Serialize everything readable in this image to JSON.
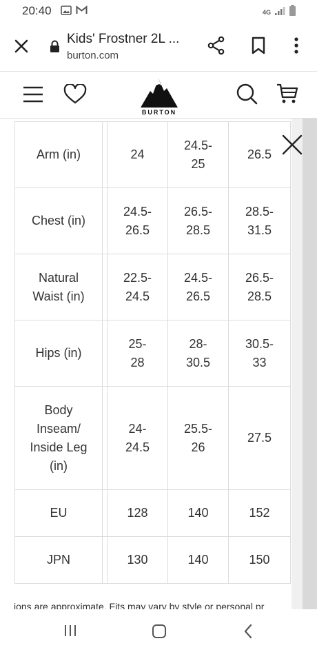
{
  "status": {
    "time": "20:40",
    "network": "4G"
  },
  "browser": {
    "title": "Kids' Frostner 2L ...",
    "url": "burton.com"
  },
  "site": {
    "logo_text": "BURTON"
  },
  "size_table": {
    "rows": [
      {
        "label": "Arm (in)",
        "values": [
          "24",
          "24.5-\n25",
          "26.5"
        ]
      },
      {
        "label": "Chest (in)",
        "values": [
          "24.5-\n26.5",
          "26.5-\n28.5",
          "28.5-\n31.5"
        ]
      },
      {
        "label": "Natural\nWaist (in)",
        "values": [
          "22.5-\n24.5",
          "24.5-\n26.5",
          "26.5-\n28.5"
        ]
      },
      {
        "label": "Hips (in)",
        "values": [
          "25-\n28",
          "28-\n30.5",
          "30.5-\n33"
        ]
      },
      {
        "label": "Body\nInseam/\nInside Leg\n(in)",
        "values": [
          "24-\n24.5",
          "25.5-\n26",
          "27.5"
        ]
      },
      {
        "label": "EU",
        "values": [
          "128",
          "140",
          "152"
        ]
      },
      {
        "label": "JPN",
        "values": [
          "130",
          "140",
          "150"
        ]
      }
    ]
  },
  "footnote": "ions are approximate. Fits may vary by style or personal pr",
  "colors": {
    "text": "#333333",
    "border": "#dcdcdc",
    "scrollbar": "#d9d9d9"
  },
  "icons": [
    "gallery-icon",
    "gmail-icon",
    "signal-icon",
    "battery-icon",
    "close-icon",
    "lock-icon",
    "share-icon",
    "bookmark-icon",
    "more-vert-icon",
    "hamburger-icon",
    "heart-icon",
    "search-icon",
    "cart-icon",
    "recent-apps-icon",
    "home-icon",
    "back-icon"
  ]
}
